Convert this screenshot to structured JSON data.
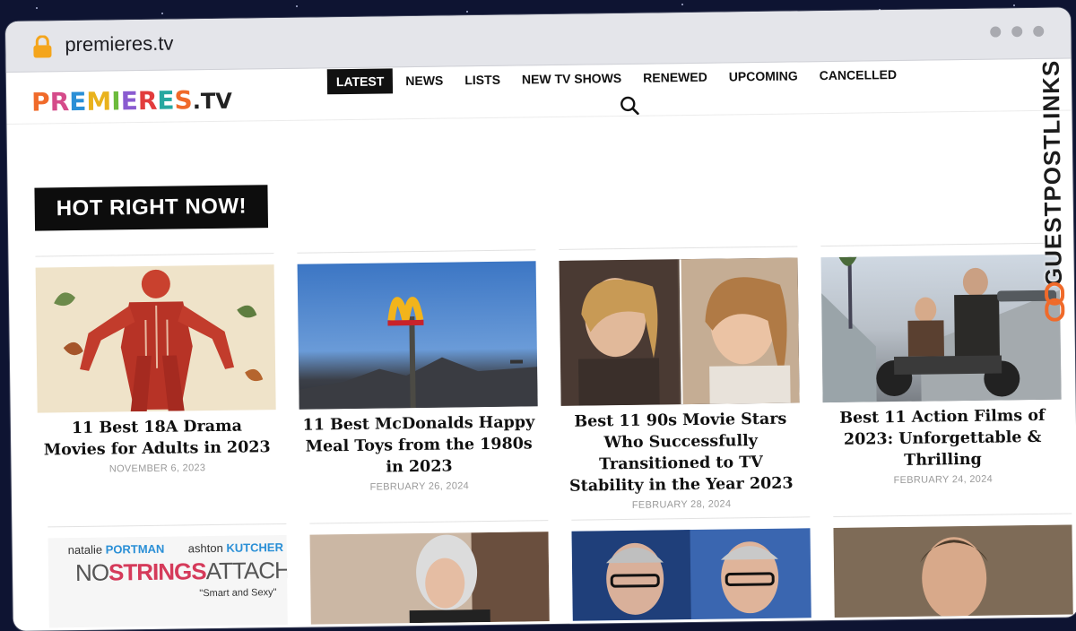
{
  "browser": {
    "url": "premieres.tv"
  },
  "site": {
    "logo_main": "PREMIERES",
    "logo_tld": ".TV"
  },
  "nav": {
    "items": [
      {
        "label": "LATEST",
        "active": true
      },
      {
        "label": "NEWS",
        "active": false
      },
      {
        "label": "LISTS",
        "active": false
      },
      {
        "label": "NEW TV SHOWS",
        "active": false
      },
      {
        "label": "RENEWED",
        "active": false
      },
      {
        "label": "UPCOMING",
        "active": false
      },
      {
        "label": "CANCELLED",
        "active": false
      }
    ]
  },
  "section": {
    "title": "HOT RIGHT NOW!"
  },
  "articles": [
    {
      "title": "11 Best 18A Drama Movies for Adults in 2023",
      "date": "NOVEMBER 6, 2023"
    },
    {
      "title": "11 Best McDonalds Happy Meal Toys from the 1980s in 2023",
      "date": "FEBRUARY 26, 2024"
    },
    {
      "title": "Best 11 90s Movie Stars Who Successfully Transitioned to TV Stability in the Year 2023",
      "date": "FEBRUARY 28, 2024"
    },
    {
      "title": "Best 11 Action Films of 2023: Unforgettable & Thrilling",
      "date": "FEBRUARY 24, 2024"
    }
  ],
  "poster": {
    "actor1_first": "natalie",
    "actor1_last": "PORTMAN",
    "actor2_first": "ashton",
    "actor2_last": "KUTCHER",
    "title_a": "NO",
    "title_b": "STRINGS",
    "title_c": "ATTACHED",
    "tagline": "\"Smart and Sexy\""
  },
  "watermark": {
    "text": "GUESTPOSTLINKS"
  },
  "colors": {
    "background": "#0e1432",
    "chrome": "#e4e5ea",
    "lock": "#f4a51c",
    "banner": "#0d0d0d",
    "brand_chain": "#f06a2a"
  }
}
